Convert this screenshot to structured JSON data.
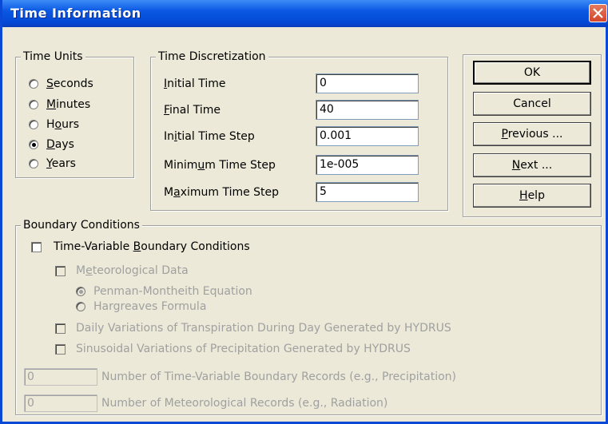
{
  "window": {
    "title": "Time Information"
  },
  "time_units": {
    "legend": "Time Units",
    "options": [
      {
        "label_u": "S",
        "label_rest": "econds",
        "checked": false
      },
      {
        "label_u": "M",
        "label_rest": "inutes",
        "checked": false
      },
      {
        "label_pre": "H",
        "label_u": "o",
        "label_rest": "urs",
        "checked": false
      },
      {
        "label_u": "D",
        "label_rest": "ays",
        "checked": true
      },
      {
        "label_u": "Y",
        "label_rest": "ears",
        "checked": false
      }
    ]
  },
  "time_discretization": {
    "legend": "Time Discretization",
    "fields": [
      {
        "label": "Initial Time",
        "value": "0"
      },
      {
        "label": "Final Time",
        "value": "40"
      },
      {
        "label": "Initial Time Step",
        "value": "0.001"
      },
      {
        "label": "Minimum Time Step",
        "value": "1e-005"
      },
      {
        "label": "Maximum Time Step",
        "value": "5"
      }
    ]
  },
  "buttons": {
    "ok": "OK",
    "cancel": "Cancel",
    "previous": "Previous ...",
    "next": "Next ...",
    "help": "Help"
  },
  "boundary": {
    "legend": "Boundary Conditions",
    "time_variable": "Time-Variable Boundary Conditions",
    "meteorological": "Meteorological Data",
    "penman": "Penman-Montheith Equation",
    "hargreaves": "Hargreaves Formula",
    "daily": "Daily Variations of Transpiration During Day Generated by HYDRUS",
    "sinusoidal": "Sinusoidal Variations of Precipitation Generated by HYDRUS",
    "records_value": "0",
    "records_label": "Number of Time-Variable Boundary Records (e.g., Precipitation)",
    "met_records_value": "0",
    "met_records_label": "Number of Meteorological Records (e.g., Radiation)"
  }
}
